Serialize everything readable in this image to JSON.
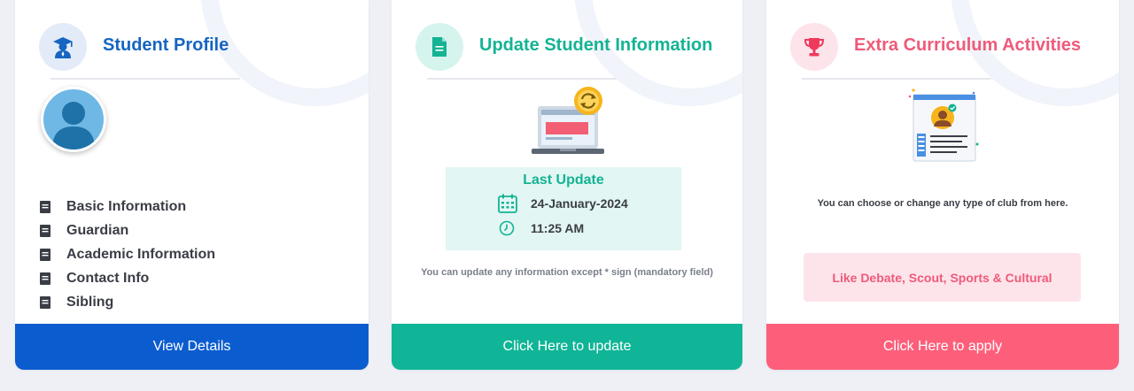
{
  "colors": {
    "profile_accent": "#1665c1",
    "update_accent": "#14b394",
    "activities_accent": "#ef5a7a",
    "profile_button": "#0b5ccf",
    "update_button": "#0fb596",
    "activities_button": "#fd5f7a"
  },
  "profile_card": {
    "title": "Student Profile",
    "icon": "graduate-icon",
    "menu": [
      {
        "label": "Basic Information",
        "icon": "list-item-icon"
      },
      {
        "label": "Guardian",
        "icon": "list-item-icon"
      },
      {
        "label": "Academic Information",
        "icon": "list-item-icon"
      },
      {
        "label": "Contact Info",
        "icon": "list-item-icon"
      },
      {
        "label": "Sibling",
        "icon": "list-item-icon"
      }
    ],
    "button_label": "View Details"
  },
  "update_card": {
    "title": "Update Student Information",
    "icon": "document-icon",
    "last_update_title": "Last Update",
    "date": "24-January-2024",
    "time": "11:25 AM",
    "note": "You can update any information except * sign (mandatory field)",
    "button_label": "Click Here to update"
  },
  "activities_card": {
    "title": "Extra Curriculum Activities",
    "icon": "trophy-icon",
    "note": "You can choose or change any type of club from here.",
    "examples": "Like Debate, Scout, Sports & Cultural",
    "button_label": "Click Here to apply"
  }
}
